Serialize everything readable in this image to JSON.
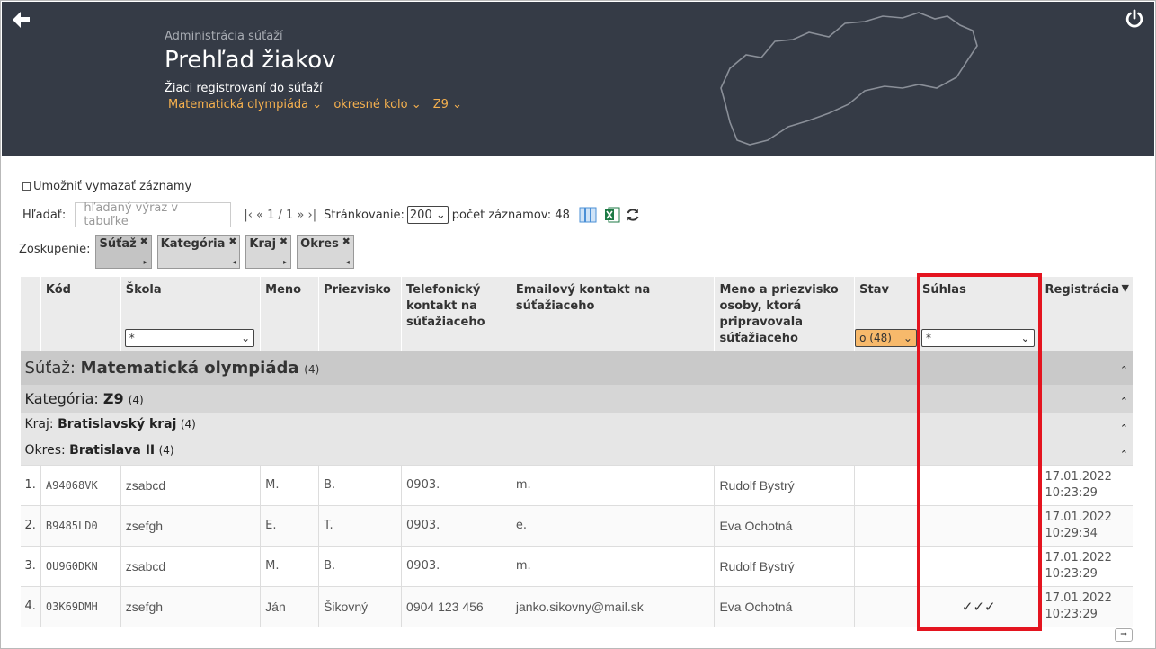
{
  "header": {
    "subtitle": "Administrácia súťaží",
    "title": "Prehľad žiakov",
    "description": "Žiaci registrovaní do súťaží",
    "filters": [
      "Matematická olympiáda",
      "okresné kolo",
      "Z9"
    ]
  },
  "toolbar": {
    "allow_delete_label": "Umožniť vymazať záznamy",
    "search_label": "Hľadať:",
    "search_placeholder": "hľadaný výraz v tabuľke",
    "pager_text": "|‹ « 1 / 1 » ›|",
    "paging_label": "Stránkovanie:",
    "paging_value": "200",
    "record_count": "počet záznamov: 48"
  },
  "grouping": {
    "label": "Zoskupenie:",
    "chips": [
      "Súťaž",
      "Kategória",
      "Kraj",
      "Okres"
    ]
  },
  "columns": {
    "kod": "Kód",
    "skola": "Škola",
    "meno": "Meno",
    "priezvisko": "Priezvisko",
    "telefon": "Telefonický kontakt na súťažiaceho",
    "email": "Emailový kontakt na súťažiaceho",
    "pripravoval": "Meno a priezvisko osoby, ktorá pripravovala súťažiaceho",
    "stav": "Stav",
    "suhlas": "Súhlas",
    "registracia": "Registrácia"
  },
  "column_filters": {
    "skola": "*",
    "stav": "o (48)",
    "suhlas": "*"
  },
  "groups": {
    "sutaz_label": "Súťaž:",
    "sutaz_value": "Matematická olympiáda",
    "sutaz_count": "(4)",
    "kategoria_label": "Kategória:",
    "kategoria_value": "Z9",
    "kategoria_count": "(4)",
    "kraj_label": "Kraj:",
    "kraj_value": "Bratislavský kraj",
    "kraj_count": "(4)",
    "okres_label": "Okres:",
    "okres_value": "Bratislava II",
    "okres_count": "(4)"
  },
  "rows": [
    {
      "n": "1.",
      "kod": "A94068VK",
      "skola": "zsabcd",
      "meno": "M.",
      "priezvisko": "B.",
      "telefon": "0903.",
      "email": "m.",
      "pripravoval": "Rudolf Bystrý",
      "stav": "",
      "suhlas": "",
      "reg_date": "17.01.2022",
      "reg_time": "10:23:29"
    },
    {
      "n": "2.",
      "kod": "B9485LD0",
      "skola": "zsefgh",
      "meno": "E.",
      "priezvisko": "T.",
      "telefon": "0903.",
      "email": "e.",
      "pripravoval": "Eva Ochotná",
      "stav": "",
      "suhlas": "",
      "reg_date": "17.01.2022",
      "reg_time": "10:29:34"
    },
    {
      "n": "3.",
      "kod": "OU9G0DKN",
      "skola": "zsabcd",
      "meno": "M.",
      "priezvisko": "B.",
      "telefon": "0903.",
      "email": "m.",
      "pripravoval": "Rudolf Bystrý",
      "stav": "",
      "suhlas": "",
      "reg_date": "17.01.2022",
      "reg_time": "10:23:29"
    },
    {
      "n": "4.",
      "kod": "03K69DMH",
      "skola": "zsefgh",
      "meno": "Ján",
      "priezvisko": "Šikovný",
      "telefon": "0904 123 456",
      "email": "janko.sikovny@mail.sk",
      "pripravoval": "Eva Ochotná",
      "stav": "",
      "suhlas": "✓✓✓",
      "reg_date": "17.01.2022",
      "reg_time": "10:23:29"
    }
  ],
  "colors": {
    "header_bg": "#353b46",
    "accent": "#f5b04e",
    "highlight": "#e4141f",
    "stav_filter": "#f7b96b"
  },
  "icons": [
    "back-arrow-icon",
    "power-icon",
    "columns-icon",
    "excel-icon",
    "refresh-icon"
  ]
}
